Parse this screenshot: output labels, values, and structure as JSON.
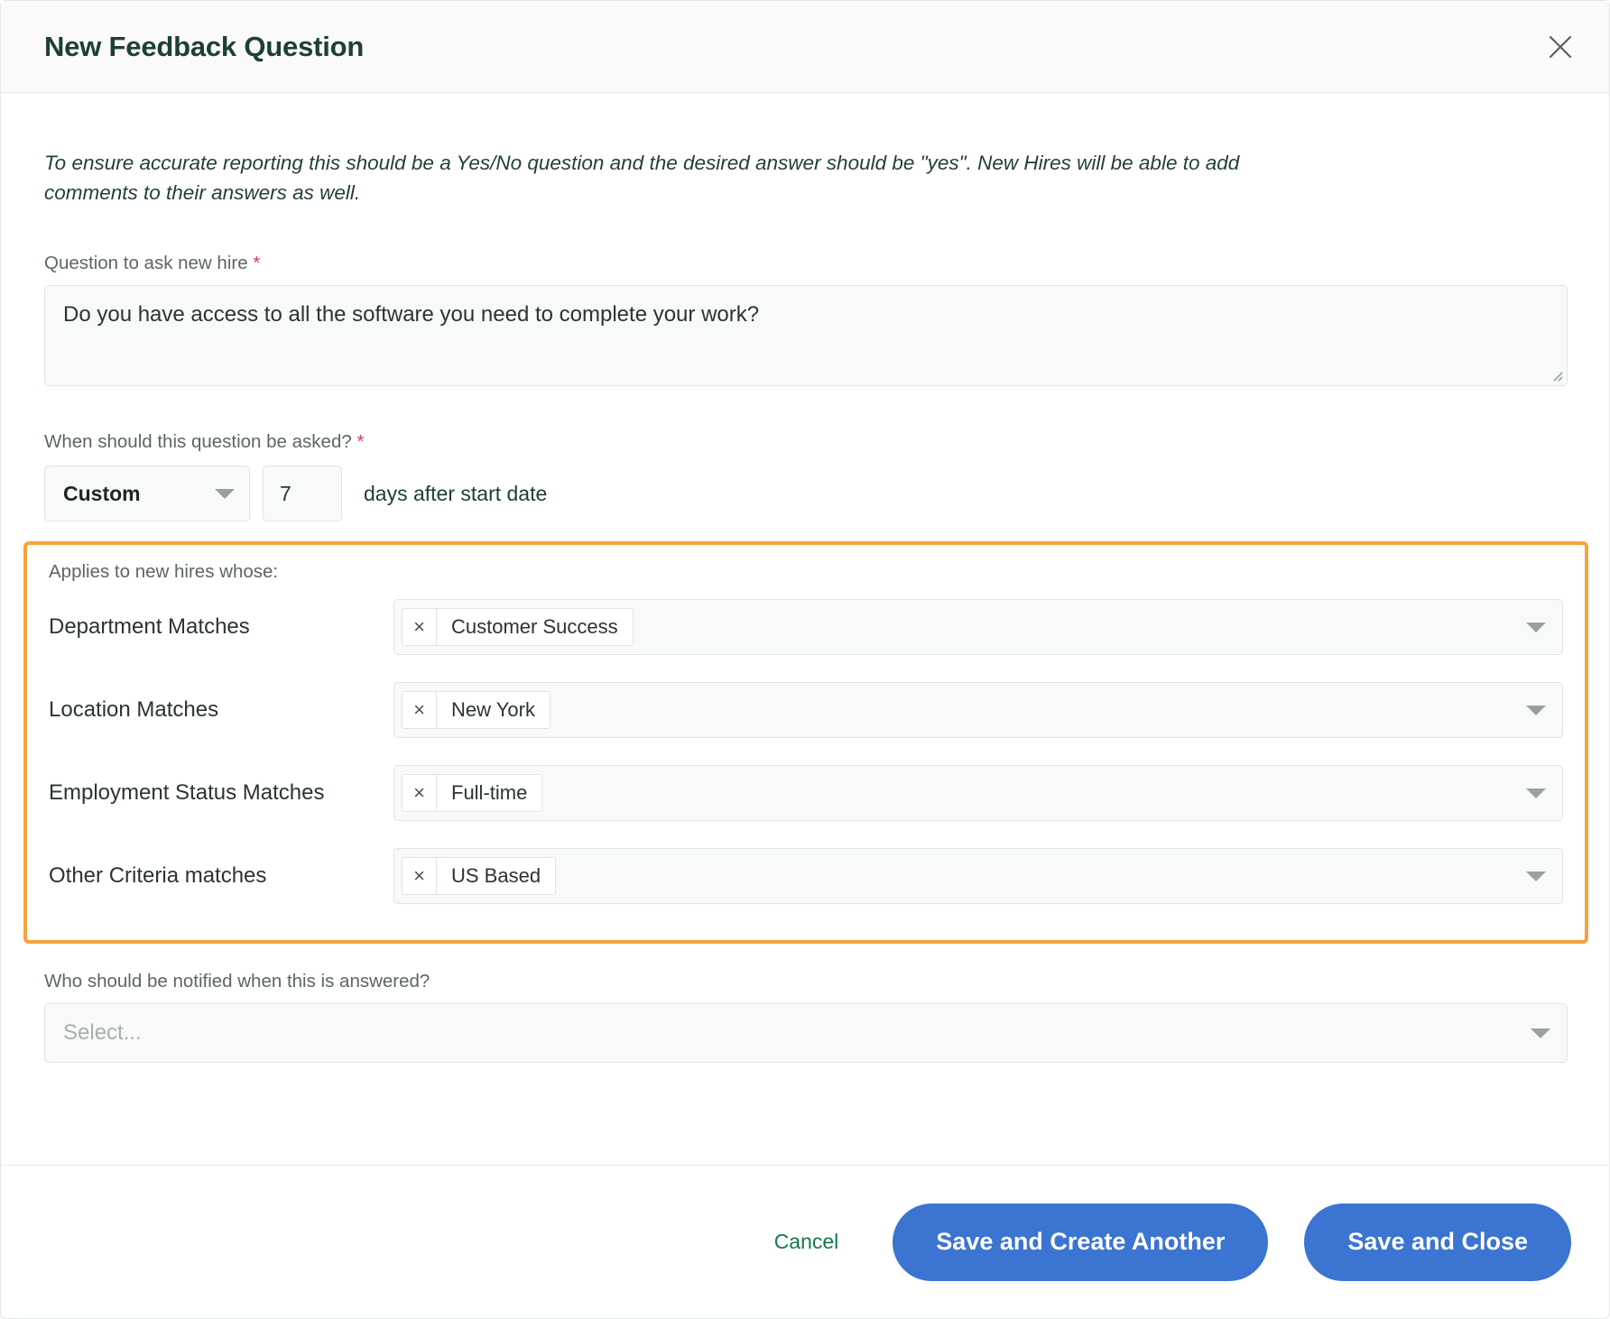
{
  "header": {
    "title": "New Feedback Question",
    "close_icon": "close-icon"
  },
  "body": {
    "intro": "To ensure accurate reporting this should be a Yes/No question and the desired answer should be \"yes\". New Hires will be able to add comments to their answers as well.",
    "question": {
      "label": "Question to ask new hire",
      "required_marker": "*",
      "value": "Do you have access to all the software you need to complete your work?"
    },
    "timing": {
      "label": "When should this question be asked?",
      "required_marker": "*",
      "selected_option": "Custom",
      "days_value": "7",
      "suffix": "days after start date"
    },
    "criteria": {
      "caption": "Applies to new hires whose:",
      "highlight_color": "#f7a33c",
      "rows": [
        {
          "label": "Department Matches",
          "tag": "Customer Success",
          "remove": "×"
        },
        {
          "label": "Location Matches",
          "tag": "New York",
          "remove": "×"
        },
        {
          "label": "Employment Status Matches",
          "tag": "Full-time",
          "remove": "×"
        },
        {
          "label": "Other Criteria matches",
          "tag": "US Based",
          "remove": "×"
        }
      ]
    },
    "notify": {
      "label": "Who should be notified when this is answered?",
      "placeholder": "Select...",
      "value": "Select..."
    }
  },
  "footer": {
    "cancel_label": "Cancel",
    "save_create_label": "Save and Create Another",
    "save_close_label": "Save and Close",
    "primary_color": "#3b74d1",
    "cancel_color": "#137a4a"
  }
}
